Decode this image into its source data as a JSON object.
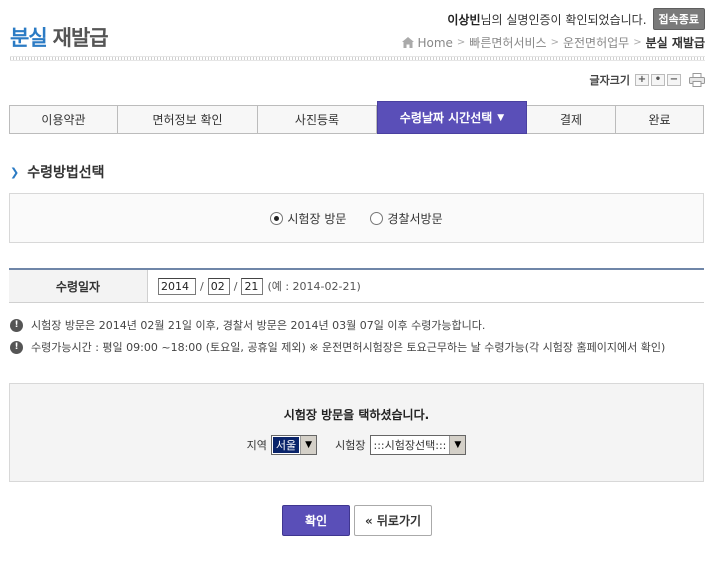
{
  "page": {
    "title_part1": "분실",
    "title_part2": "재발급"
  },
  "user": {
    "name": "이상빈",
    "message": "님의 실명인증이 확인되었습니다.",
    "logout_label": "접속종료"
  },
  "breadcrumb": {
    "items": [
      "Home",
      "빠른면허서비스",
      "운전면허업무",
      "분실 재발급"
    ]
  },
  "font_size": {
    "label": "글자크기",
    "increase": "+",
    "reset": "•",
    "decrease": "−"
  },
  "steps": [
    {
      "label": "이용약관"
    },
    {
      "label": "면허정보 확인"
    },
    {
      "label": "사진등록"
    },
    {
      "label": "수령날짜 시간선택",
      "active": true
    },
    {
      "label": "결제"
    },
    {
      "label": "완료"
    }
  ],
  "section": {
    "title": "수령방법선택"
  },
  "method": {
    "options": [
      "시험장 방문",
      "경찰서방문"
    ],
    "selected": "시험장 방문"
  },
  "date": {
    "label": "수령일자",
    "year": "2014",
    "month": "02",
    "day": "21",
    "sep": "/",
    "hint": "(예 : 2014-02-21)"
  },
  "notices": [
    "시험장 방문은 2014년 02월 21일 이후, 경찰서 방문은 2014년 03월 07일 이후 수령가능합니다.",
    "수령가능시간 : 평일 09:00 ~18:00 (토요일, 공휴일 제외) ※ 운전면허시험장은 토요근무하는 날 수령가능(각 시험장 홈페이지에서 확인)"
  ],
  "selection": {
    "message": "시험장 방문을 택하셨습니다.",
    "region_label": "지역",
    "region_value": "서울",
    "center_label": "시험장",
    "center_value": ":::시험장선택:::"
  },
  "buttons": {
    "confirm": "확인",
    "back": "« 뒤로가기"
  },
  "colors": {
    "accent": "#5a4fb8",
    "title_blue": "#2b7bc4"
  }
}
